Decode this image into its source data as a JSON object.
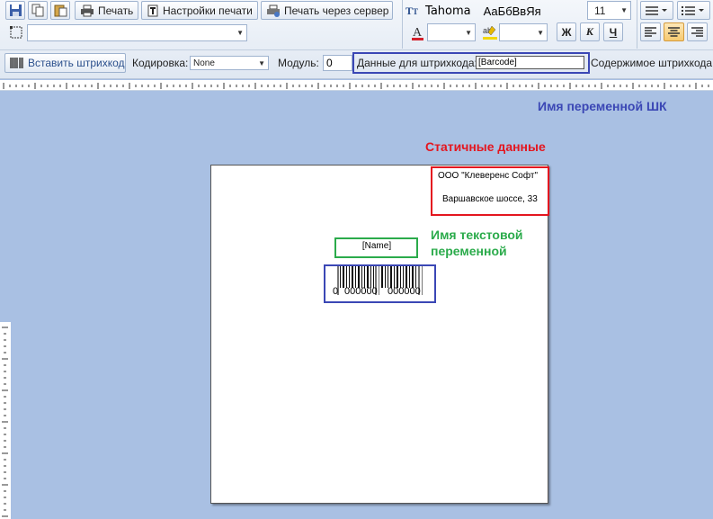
{
  "toolbar": {
    "print_label": "Печать",
    "print_settings_label": "Настройки печати",
    "server_print_label": "Печать через сервер",
    "font_name": "Tahoma",
    "font_preview": "АаБбВвЯя",
    "font_size": "11",
    "bold_label": "Ж",
    "italic_label": "К",
    "underline_label": "Ч"
  },
  "barcode_bar": {
    "insert_label": "Вставить штрихкод",
    "encoding_label": "Кодировка:",
    "encoding_value": "None",
    "module_label": "Модуль:",
    "module_value": "0",
    "data_label": "Данные для штрихкода:",
    "data_value": "[Barcode]",
    "content_label": "Содержимое штрихкода:"
  },
  "label_page": {
    "company": "ООО \"Клеверенс Софт\"",
    "address": "Варшавское шоссе, 33",
    "name_field": "[Name]",
    "barcode_digits": [
      "0",
      "000000",
      "000000"
    ]
  },
  "annotations": {
    "barcode_var": "Имя переменной ШК",
    "static_data": "Статичные данные",
    "text_var_line1": "Имя текстовой",
    "text_var_line2": "переменной",
    "blue": "#3b47b5",
    "red": "#e4161f",
    "green": "#2bab4b"
  }
}
